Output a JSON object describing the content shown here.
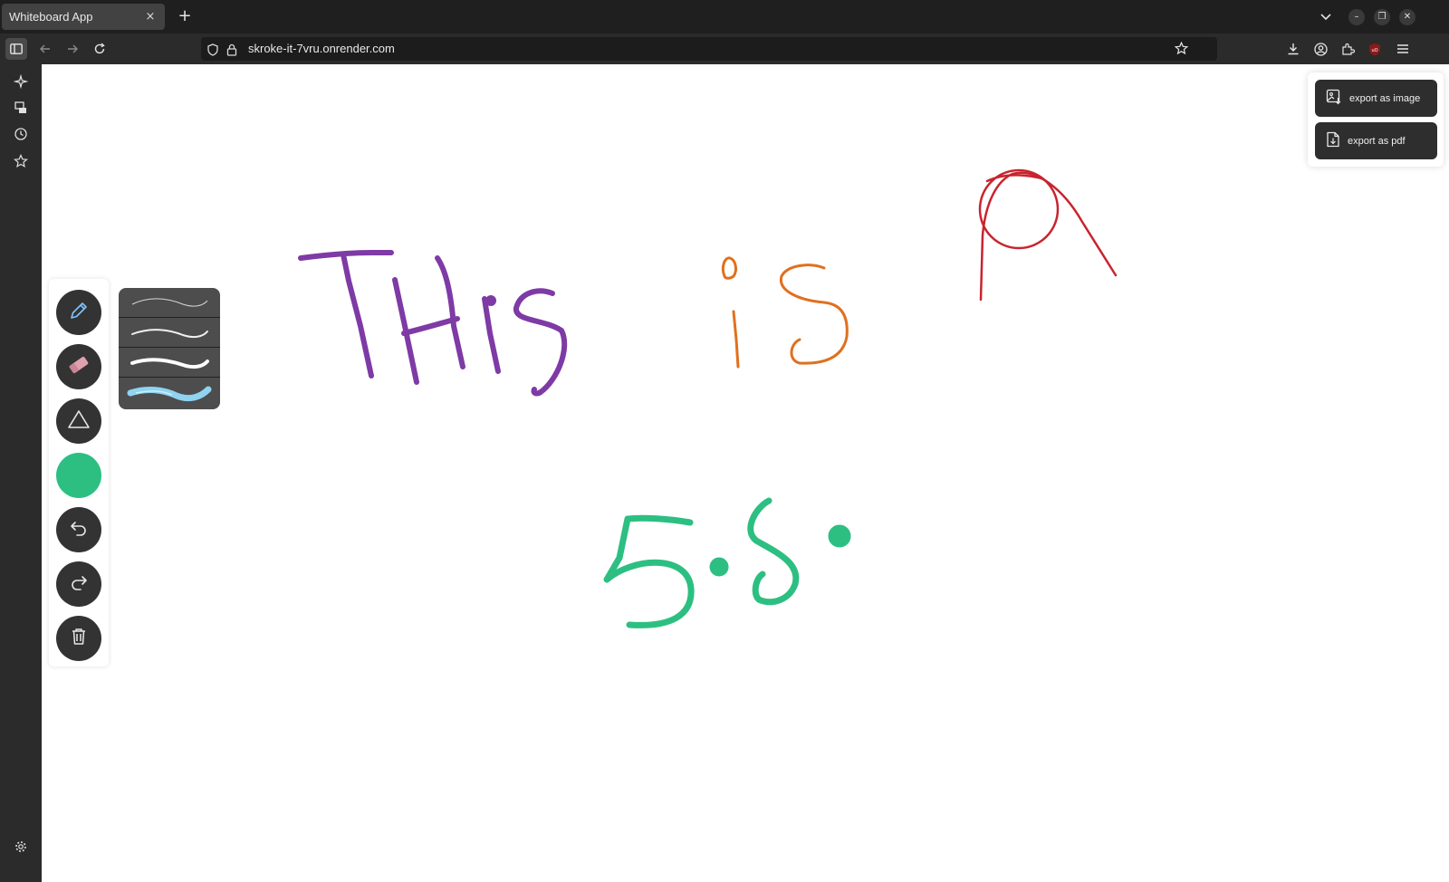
{
  "browser": {
    "tab_title": "Whiteboard App",
    "tab_close": "×",
    "new_tab": "+",
    "url": "skroke-it-7vru.onrender.com"
  },
  "export_menu": {
    "image_label": "export as image",
    "pdf_label": "export as pdf"
  },
  "toolbar": {
    "tools": [
      "pencil-tool",
      "eraser-tool",
      "shape-tool",
      "color-picker",
      "undo",
      "redo",
      "clear-canvas"
    ],
    "selected_color": "#2dbf82"
  },
  "stroke_options": [
    "thin",
    "medium",
    "thick",
    "brush"
  ],
  "drawings": [
    {
      "text": "THis",
      "color": "#7e3aa5"
    },
    {
      "text": "is",
      "color": "#e0701e"
    },
    {
      "text": "a",
      "color": "#c8242f"
    },
    {
      "text": "5.5.",
      "color": "#2dbf82"
    }
  ],
  "colors": {
    "chrome_dark": "#1f1f1f",
    "chrome": "#2b2b2b",
    "tool_bg": "#333333"
  }
}
